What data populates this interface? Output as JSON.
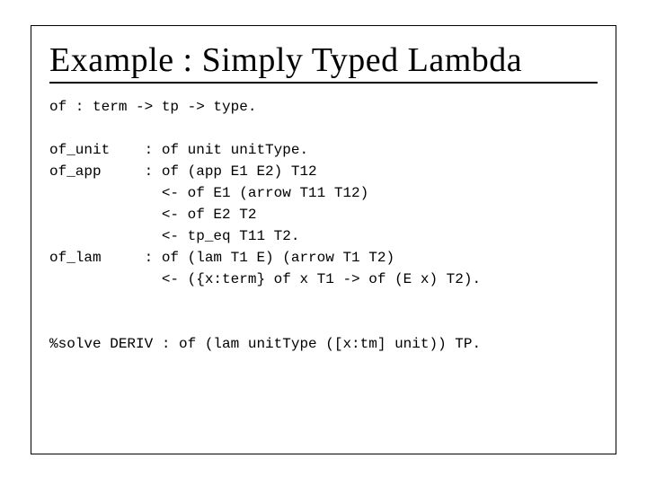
{
  "title": "Example : Simply Typed Lambda",
  "code": {
    "l1": "of : term -> tp -> type.",
    "l2": "",
    "l3": "of_unit    : of unit unitType.",
    "l4": "of_app     : of (app E1 E2) T12",
    "l5": "             <- of E1 (arrow T11 T12)",
    "l6": "             <- of E2 T2",
    "l7": "             <- tp_eq T11 T2.",
    "l8": "of_lam     : of (lam T1 E) (arrow T1 T2)",
    "l9": "             <- ({x:term} of x T1 -> of (E x) T2).",
    "l10": "",
    "l11": "",
    "l12": "%solve DERIV : of (lam unitType ([x:tm] unit)) TP."
  }
}
